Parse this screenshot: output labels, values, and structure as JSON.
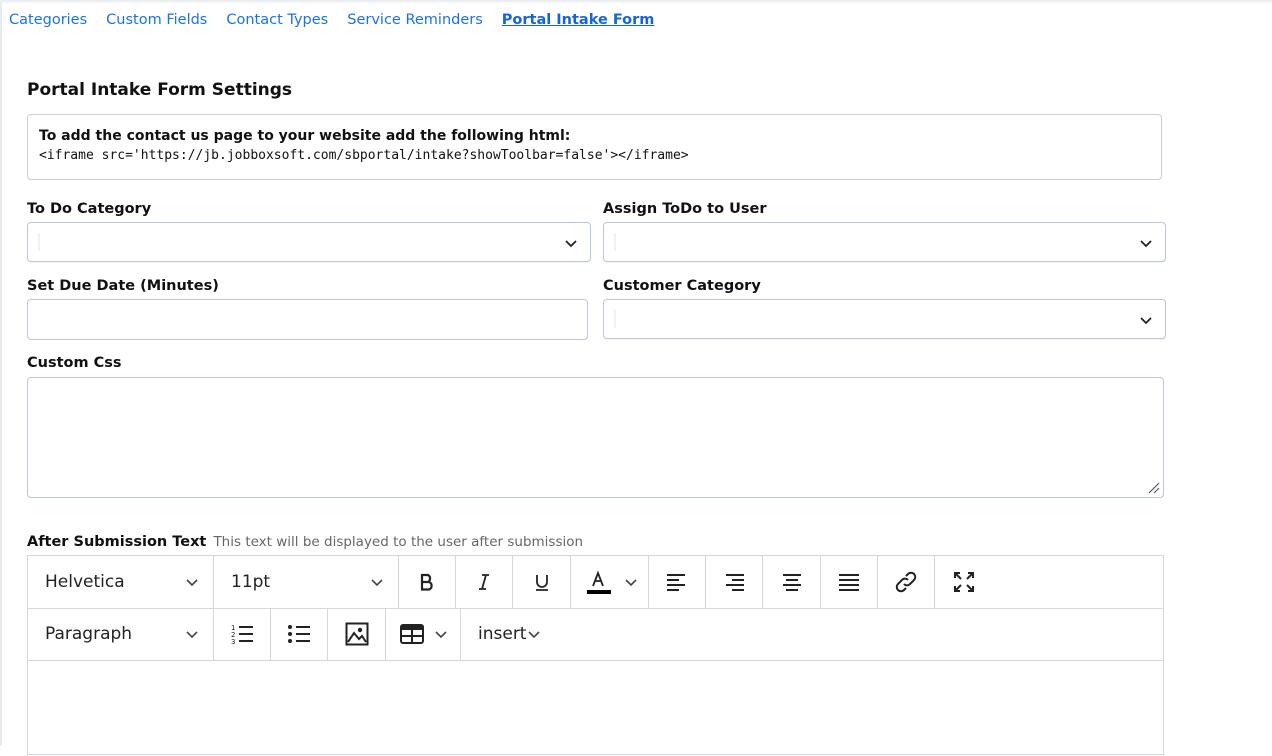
{
  "tabs": [
    {
      "label": "Categories",
      "active": false
    },
    {
      "label": "Custom Fields",
      "active": false
    },
    {
      "label": "Contact Types",
      "active": false
    },
    {
      "label": "Service Reminders",
      "active": false
    },
    {
      "label": "Portal Intake Form",
      "active": true
    }
  ],
  "page": {
    "title": "Portal Intake Form Settings",
    "info_title": "To add the contact us page to your website add the following html:",
    "info_code": "<iframe src='https://jb.jobboxsoft.com/sbportal/intake?showToolbar=false'></iframe>"
  },
  "fields": {
    "todo_category": {
      "label": "To Do Category",
      "value": ""
    },
    "assign_todo": {
      "label": "Assign ToDo to User",
      "value": ""
    },
    "due_date": {
      "label": "Set Due Date (Minutes)",
      "value": ""
    },
    "customer_category": {
      "label": "Customer Category",
      "value": ""
    },
    "custom_css": {
      "label": "Custom Css",
      "value": ""
    }
  },
  "after_submission": {
    "label": "After Submission Text",
    "hint": "This text will be displayed to the user after submission"
  },
  "editor": {
    "font_family": "Helvetica",
    "font_size": "11pt",
    "block_format": "Paragraph",
    "insert_label": "insert",
    "text_color": "#000000"
  },
  "colors": {
    "link": "#1a73e8",
    "border": "#b9c7d6"
  }
}
